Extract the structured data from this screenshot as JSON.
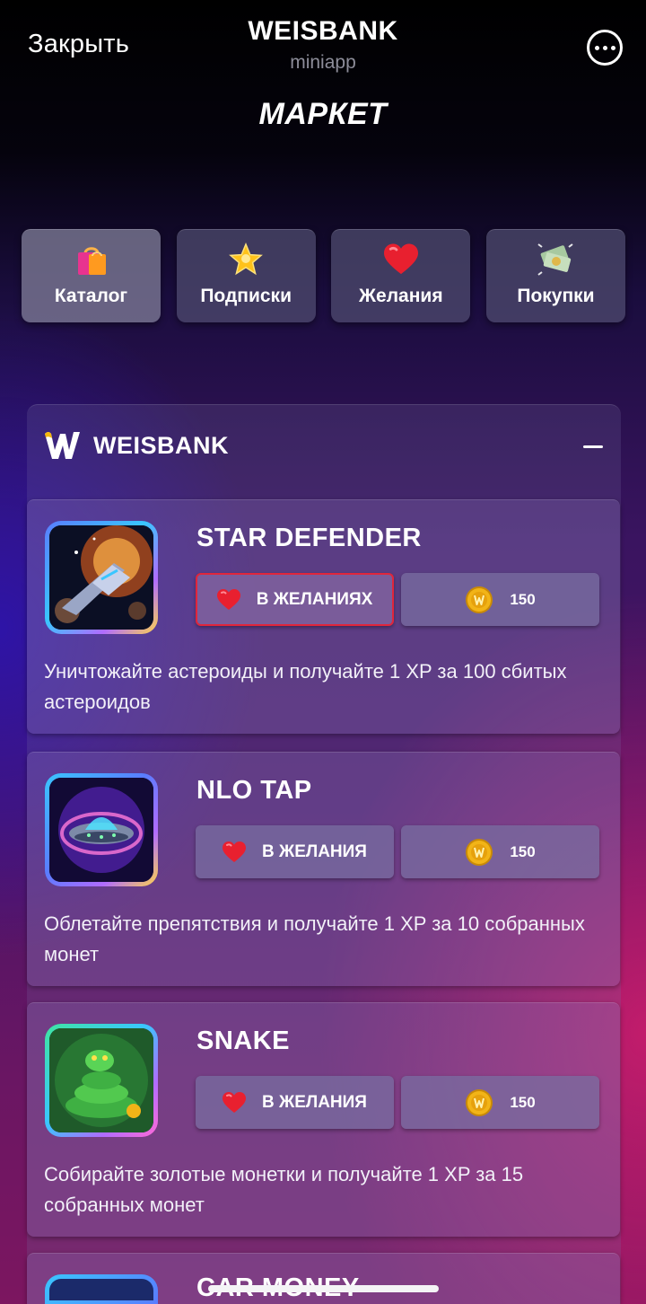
{
  "topbar": {
    "close_label": "Закрыть",
    "app_title": "WEISBANK",
    "app_subtitle": "miniapp",
    "menu_icon": "more-icon"
  },
  "page_title": "МАРКЕТ",
  "tabs": [
    {
      "label": "Каталог",
      "icon": "shopping-bag-icon",
      "active": true
    },
    {
      "label": "Подписки",
      "icon": "star-icon",
      "active": false
    },
    {
      "label": "Желания",
      "icon": "heart-icon",
      "active": false
    },
    {
      "label": "Покупки",
      "icon": "money-icon",
      "active": false
    }
  ],
  "section": {
    "brand": "WEISBANK",
    "collapse_icon": "minus-icon"
  },
  "games": [
    {
      "title": "STAR DEFENDER",
      "wish_label": "В ЖЕЛАНИЯХ",
      "in_wishlist": true,
      "price": "150",
      "description": "Уничтожайте астероиды и получайте 1 XP за 100 сбитых астероидов"
    },
    {
      "title": "NLO TAP",
      "wish_label": "В ЖЕЛАНИЯ",
      "in_wishlist": false,
      "price": "150",
      "description": "Облетайте препятствия и получайте 1 XP за 10 собранных монет"
    },
    {
      "title": "SNAKE",
      "wish_label": "В ЖЕЛАНИЯ",
      "in_wishlist": false,
      "price": "150",
      "description": "Собирайте золотые монетки и получайте 1 XP за 15 собранных монет"
    },
    {
      "title": "CAR MONEY"
    }
  ],
  "colors": {
    "accent_red": "#e0263c",
    "coin_gold": "#f2b417",
    "brand_yellow": "#f5b70c"
  }
}
